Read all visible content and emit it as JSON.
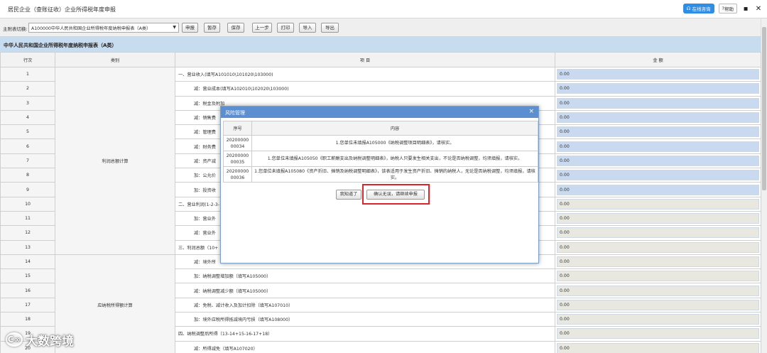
{
  "window": {
    "title": "居民企业（查账征收）企业所得税年度申报",
    "online_consult_label": "在线咨询",
    "help_label": "帮助"
  },
  "toolbar": {
    "main_table_label": "主附表切换:",
    "main_table_value": "A100000中华人民共和国企业所得税年度纳税申报表（A类）",
    "buttons": [
      "申报",
      "暂存",
      "保存",
      "上一步",
      "打印",
      "导入",
      "导出"
    ]
  },
  "table": {
    "title": "中华人民共和国企业所得税年度纳税申报表（A类）",
    "headers": {
      "row_no": "行次",
      "category": "类别",
      "item": "项 目",
      "amount": "金 额"
    },
    "categories": {
      "profit": "利润总额计算",
      "taxable": "应纳税所得额计算"
    },
    "rows": [
      {
        "no": "1",
        "item": "一、营业收入(填写A101010\\101020\\103000)",
        "amount": "0.00",
        "amount_style": "blue"
      },
      {
        "no": "2",
        "item": "减：营业成本(填写A102010\\102020\\103000)",
        "amount": "0.00",
        "amount_style": "blue"
      },
      {
        "no": "3",
        "item": "减：税金及附加",
        "amount": "0.00",
        "amount_style": "blue"
      },
      {
        "no": "4",
        "item": "减：销售费",
        "amount": "0.00",
        "amount_style": "blue"
      },
      {
        "no": "5",
        "item": "减：管理费",
        "amount": "0.00",
        "amount_style": "blue"
      },
      {
        "no": "6",
        "item": "减：财务费",
        "amount": "0.00",
        "amount_style": "blue"
      },
      {
        "no": "7",
        "item": "减：资产减",
        "amount": "0.00",
        "amount_style": "blue"
      },
      {
        "no": "8",
        "item": "加：公允价",
        "amount": "0.00",
        "amount_style": "blue"
      },
      {
        "no": "9",
        "item": "加：投资收",
        "amount": "0.00",
        "amount_style": "blue"
      },
      {
        "no": "10",
        "item": "二、营业利润(1-2-3-",
        "amount": "0.00",
        "amount_style": "grey"
      },
      {
        "no": "11",
        "item": "加：营业外",
        "amount": "0.00",
        "amount_style": "grey"
      },
      {
        "no": "12",
        "item": "减：营业外",
        "amount": "0.00",
        "amount_style": "grey"
      },
      {
        "no": "13",
        "item": "三、利润总额（10+",
        "amount": "0.00",
        "amount_style": "grey"
      },
      {
        "no": "14",
        "item": "减：境外所",
        "amount": "0.00",
        "amount_style": "grey"
      },
      {
        "no": "15",
        "item": "加：纳税调整增加额（填写A105000）",
        "amount": "0.00",
        "amount_style": "grey"
      },
      {
        "no": "16",
        "item": "减：纳税调整减少额（填写A105000）",
        "amount": "0.00",
        "amount_style": "grey"
      },
      {
        "no": "17",
        "item": "减：免税、减计收入及加计扣除（填写A107010）",
        "amount": "0.00",
        "amount_style": "grey"
      },
      {
        "no": "18",
        "item": "加：境外应税所得抵减境内亏损（填写A108000）",
        "amount": "0.00",
        "amount_style": "grey"
      },
      {
        "no": "19",
        "item": "四、纳税调整后所得（13-14+15-16-17+18）",
        "amount": "0.00",
        "amount_style": "grey"
      },
      {
        "no": "20",
        "item": "减：所得减免（填写A107020）",
        "amount": "0.00",
        "amount_style": "grey"
      }
    ]
  },
  "dialog": {
    "title": "风险管理",
    "headers": {
      "seq": "序号",
      "content": "内容"
    },
    "rows": [
      {
        "seq": "2020000000034",
        "content": "1.您单位未填报A105000《纳税调整项目明细表》，请核实。"
      },
      {
        "seq": "2020000000035",
        "content": "1.您单位未填报A105050《职工薪酬支出及纳税调整明细表》，纳税人只要发生相关支出，不论是否纳税调整，均须填报，请核实。"
      },
      {
        "seq": "2020000000036",
        "content": "1.您单位未填报A105080《资产折旧、摊销及纳税调整明细表》，该表适用于发生资产折旧、摊销的纳税人，无论是否纳税调整，均须填报，请核实。"
      }
    ],
    "btn_ack": "我知道了",
    "btn_confirm": "确认无误，请继续申报"
  },
  "watermark": {
    "text": "大数跨境"
  }
}
